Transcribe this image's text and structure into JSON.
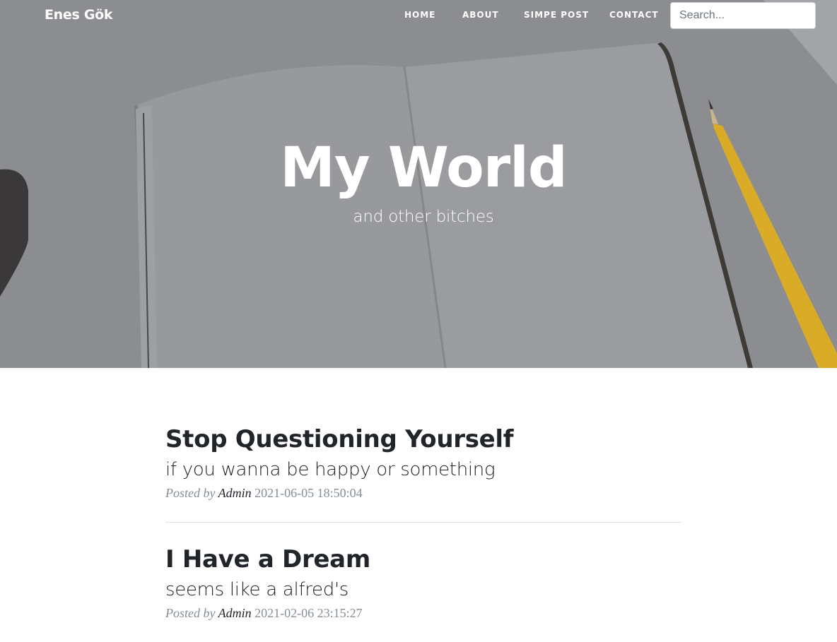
{
  "nav": {
    "brand": "Enes Gök",
    "links": [
      "HOME",
      "ABOUT",
      "SIMPE POST",
      "CONTACT"
    ],
    "search_placeholder": "Search..."
  },
  "hero": {
    "title": "My World",
    "subtitle": "and other bitches"
  },
  "posts": [
    {
      "title": "Stop Questioning Yourself",
      "subtitle": "if you wanna be happy or something",
      "posted_by": "Posted by",
      "author": "Admin",
      "date": "2021-06-05 18:50:04"
    },
    {
      "title": "I Have a Dream",
      "subtitle": "seems like a alfred's",
      "posted_by": "Posted by",
      "author": "Admin",
      "date": "2021-02-06 23:15:27"
    }
  ],
  "colors": {
    "hero_overlay": "#8d8f93",
    "text_dark": "#212529",
    "meta_gray": "#868e96",
    "pencil_yellow": "#e3b22b"
  },
  "icons": {
    "hero_image": "notebook-and-pencil"
  }
}
